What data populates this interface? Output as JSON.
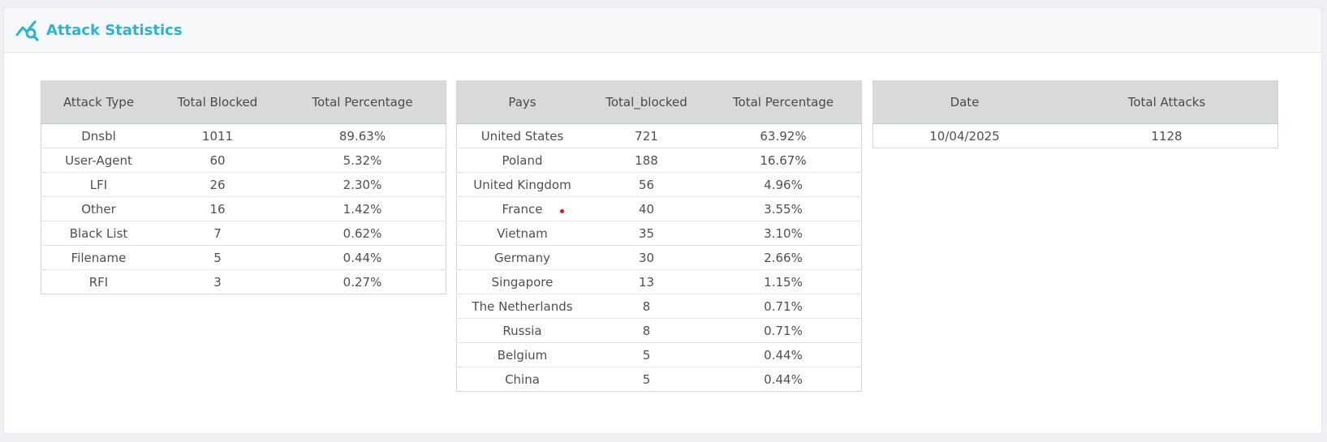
{
  "panel": {
    "title": "Attack Statistics",
    "icon": "chart-search-icon",
    "accent_color": "#2bb3d3"
  },
  "attack_types": {
    "headers": [
      "Attack Type",
      "Total Blocked",
      "Total Percentage"
    ],
    "rows": [
      [
        "Dnsbl",
        "1011",
        "89.63%"
      ],
      [
        "User-Agent",
        "60",
        "5.32%"
      ],
      [
        "LFI",
        "26",
        "2.30%"
      ],
      [
        "Other",
        "16",
        "1.42%"
      ],
      [
        "Black List",
        "7",
        "0.62%"
      ],
      [
        "Filename",
        "5",
        "0.44%"
      ],
      [
        "RFI",
        "3",
        "0.27%"
      ]
    ]
  },
  "countries": {
    "headers": [
      "Pays",
      "Total_blocked",
      "Total Percentage"
    ],
    "rows": [
      [
        "United States",
        "721",
        "63.92%"
      ],
      [
        "Poland",
        "188",
        "16.67%"
      ],
      [
        "United Kingdom",
        "56",
        "4.96%"
      ],
      [
        "France",
        "40",
        "3.55%"
      ],
      [
        "Vietnam",
        "35",
        "3.10%"
      ],
      [
        "Germany",
        "30",
        "2.66%"
      ],
      [
        "Singapore",
        "13",
        "1.15%"
      ],
      [
        "The Netherlands",
        "8",
        "0.71%"
      ],
      [
        "Russia",
        "8",
        "0.71%"
      ],
      [
        "Belgium",
        "5",
        "0.44%"
      ],
      [
        "China",
        "5",
        "0.44%"
      ]
    ]
  },
  "daily": {
    "headers": [
      "Date",
      "Total Attacks"
    ],
    "rows": [
      [
        "10/04/2025",
        "1128"
      ]
    ]
  }
}
